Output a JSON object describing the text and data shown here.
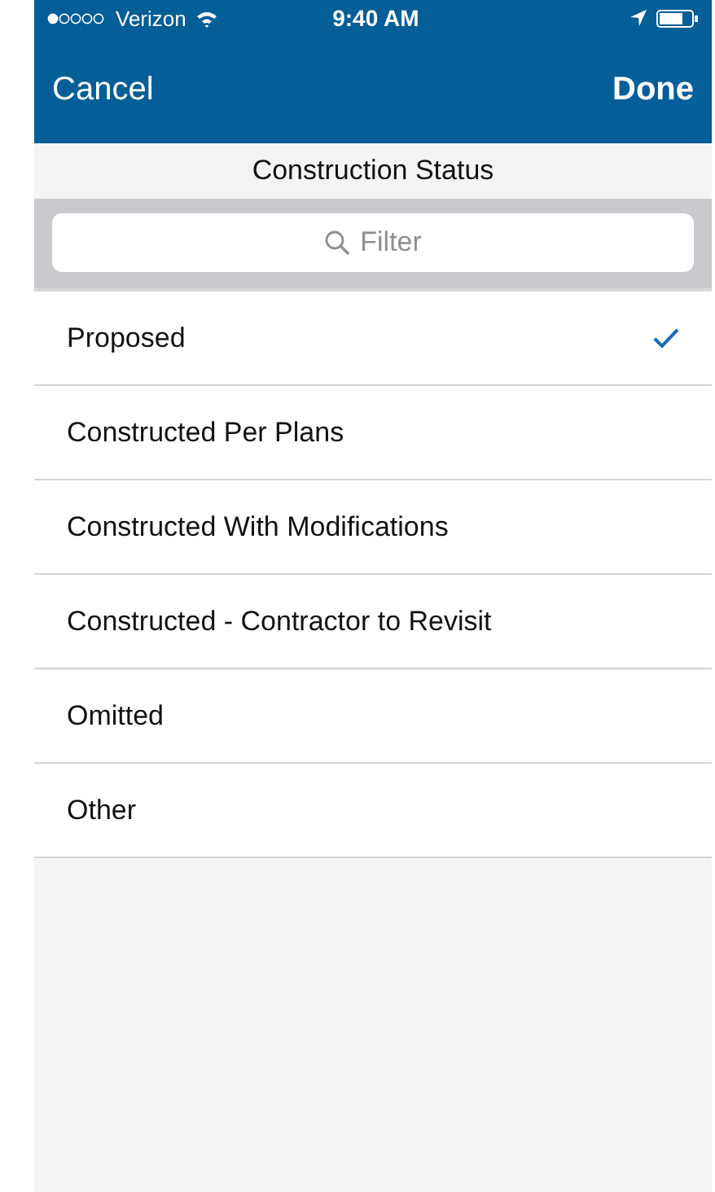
{
  "status_bar": {
    "carrier": "Verizon",
    "time": "9:40 AM"
  },
  "nav_bar": {
    "cancel": "Cancel",
    "done": "Done"
  },
  "title": "Construction Status",
  "search": {
    "placeholder": "Filter"
  },
  "options": [
    {
      "label": "Proposed",
      "selected": true
    },
    {
      "label": "Constructed Per Plans",
      "selected": false
    },
    {
      "label": "Constructed With Modifications",
      "selected": false
    },
    {
      "label": "Constructed - Contractor to Revisit",
      "selected": false
    },
    {
      "label": "Omitted",
      "selected": false
    },
    {
      "label": "Other",
      "selected": false
    }
  ]
}
